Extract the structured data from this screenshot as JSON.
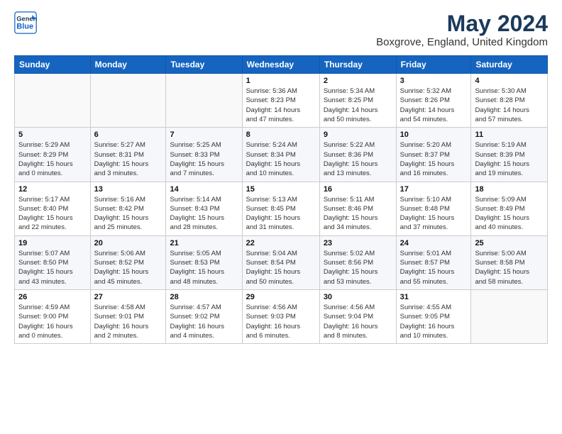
{
  "logo": {
    "line1": "General",
    "line2": "Blue"
  },
  "title": "May 2024",
  "location": "Boxgrove, England, United Kingdom",
  "weekdays": [
    "Sunday",
    "Monday",
    "Tuesday",
    "Wednesday",
    "Thursday",
    "Friday",
    "Saturday"
  ],
  "weeks": [
    [
      {
        "day": "",
        "info": ""
      },
      {
        "day": "",
        "info": ""
      },
      {
        "day": "",
        "info": ""
      },
      {
        "day": "1",
        "info": "Sunrise: 5:36 AM\nSunset: 8:23 PM\nDaylight: 14 hours\nand 47 minutes."
      },
      {
        "day": "2",
        "info": "Sunrise: 5:34 AM\nSunset: 8:25 PM\nDaylight: 14 hours\nand 50 minutes."
      },
      {
        "day": "3",
        "info": "Sunrise: 5:32 AM\nSunset: 8:26 PM\nDaylight: 14 hours\nand 54 minutes."
      },
      {
        "day": "4",
        "info": "Sunrise: 5:30 AM\nSunset: 8:28 PM\nDaylight: 14 hours\nand 57 minutes."
      }
    ],
    [
      {
        "day": "5",
        "info": "Sunrise: 5:29 AM\nSunset: 8:29 PM\nDaylight: 15 hours\nand 0 minutes."
      },
      {
        "day": "6",
        "info": "Sunrise: 5:27 AM\nSunset: 8:31 PM\nDaylight: 15 hours\nand 3 minutes."
      },
      {
        "day": "7",
        "info": "Sunrise: 5:25 AM\nSunset: 8:33 PM\nDaylight: 15 hours\nand 7 minutes."
      },
      {
        "day": "8",
        "info": "Sunrise: 5:24 AM\nSunset: 8:34 PM\nDaylight: 15 hours\nand 10 minutes."
      },
      {
        "day": "9",
        "info": "Sunrise: 5:22 AM\nSunset: 8:36 PM\nDaylight: 15 hours\nand 13 minutes."
      },
      {
        "day": "10",
        "info": "Sunrise: 5:20 AM\nSunset: 8:37 PM\nDaylight: 15 hours\nand 16 minutes."
      },
      {
        "day": "11",
        "info": "Sunrise: 5:19 AM\nSunset: 8:39 PM\nDaylight: 15 hours\nand 19 minutes."
      }
    ],
    [
      {
        "day": "12",
        "info": "Sunrise: 5:17 AM\nSunset: 8:40 PM\nDaylight: 15 hours\nand 22 minutes."
      },
      {
        "day": "13",
        "info": "Sunrise: 5:16 AM\nSunset: 8:42 PM\nDaylight: 15 hours\nand 25 minutes."
      },
      {
        "day": "14",
        "info": "Sunrise: 5:14 AM\nSunset: 8:43 PM\nDaylight: 15 hours\nand 28 minutes."
      },
      {
        "day": "15",
        "info": "Sunrise: 5:13 AM\nSunset: 8:45 PM\nDaylight: 15 hours\nand 31 minutes."
      },
      {
        "day": "16",
        "info": "Sunrise: 5:11 AM\nSunset: 8:46 PM\nDaylight: 15 hours\nand 34 minutes."
      },
      {
        "day": "17",
        "info": "Sunrise: 5:10 AM\nSunset: 8:48 PM\nDaylight: 15 hours\nand 37 minutes."
      },
      {
        "day": "18",
        "info": "Sunrise: 5:09 AM\nSunset: 8:49 PM\nDaylight: 15 hours\nand 40 minutes."
      }
    ],
    [
      {
        "day": "19",
        "info": "Sunrise: 5:07 AM\nSunset: 8:50 PM\nDaylight: 15 hours\nand 43 minutes."
      },
      {
        "day": "20",
        "info": "Sunrise: 5:06 AM\nSunset: 8:52 PM\nDaylight: 15 hours\nand 45 minutes."
      },
      {
        "day": "21",
        "info": "Sunrise: 5:05 AM\nSunset: 8:53 PM\nDaylight: 15 hours\nand 48 minutes."
      },
      {
        "day": "22",
        "info": "Sunrise: 5:04 AM\nSunset: 8:54 PM\nDaylight: 15 hours\nand 50 minutes."
      },
      {
        "day": "23",
        "info": "Sunrise: 5:02 AM\nSunset: 8:56 PM\nDaylight: 15 hours\nand 53 minutes."
      },
      {
        "day": "24",
        "info": "Sunrise: 5:01 AM\nSunset: 8:57 PM\nDaylight: 15 hours\nand 55 minutes."
      },
      {
        "day": "25",
        "info": "Sunrise: 5:00 AM\nSunset: 8:58 PM\nDaylight: 15 hours\nand 58 minutes."
      }
    ],
    [
      {
        "day": "26",
        "info": "Sunrise: 4:59 AM\nSunset: 9:00 PM\nDaylight: 16 hours\nand 0 minutes."
      },
      {
        "day": "27",
        "info": "Sunrise: 4:58 AM\nSunset: 9:01 PM\nDaylight: 16 hours\nand 2 minutes."
      },
      {
        "day": "28",
        "info": "Sunrise: 4:57 AM\nSunset: 9:02 PM\nDaylight: 16 hours\nand 4 minutes."
      },
      {
        "day": "29",
        "info": "Sunrise: 4:56 AM\nSunset: 9:03 PM\nDaylight: 16 hours\nand 6 minutes."
      },
      {
        "day": "30",
        "info": "Sunrise: 4:56 AM\nSunset: 9:04 PM\nDaylight: 16 hours\nand 8 minutes."
      },
      {
        "day": "31",
        "info": "Sunrise: 4:55 AM\nSunset: 9:05 PM\nDaylight: 16 hours\nand 10 minutes."
      },
      {
        "day": "",
        "info": ""
      }
    ]
  ]
}
